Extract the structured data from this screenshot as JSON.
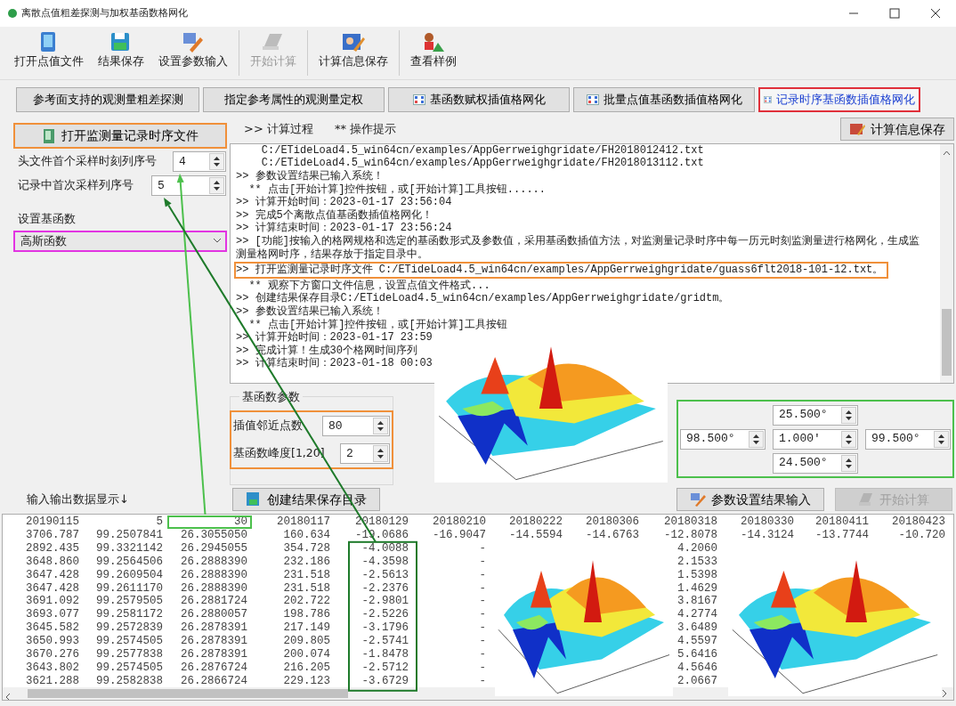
{
  "window": {
    "title": "离散点值粗差探测与加权基函数格网化"
  },
  "toolbar": [
    {
      "label": "打开点值文件",
      "disabled": false
    },
    {
      "label": "结果保存",
      "disabled": false
    },
    {
      "label": "设置参数输入",
      "disabled": false
    },
    {
      "label": "开始计算",
      "disabled": true
    },
    {
      "label": "计算信息保存",
      "disabled": false
    },
    {
      "label": "查看样例",
      "disabled": false
    }
  ],
  "tabs": [
    {
      "label": "参考面支持的观测量粗差探测",
      "kind": "text",
      "selected": false
    },
    {
      "label": "指定参考属性的观测量定权",
      "kind": "text",
      "selected": false
    },
    {
      "label": "基函数赋权插值格网化",
      "kind": "icon",
      "selected": false
    },
    {
      "label": "批量点值基函数插值格网化",
      "kind": "icon",
      "selected": false
    },
    {
      "label": "记录时序基函数插值格网化",
      "kind": "icon",
      "selected": true
    }
  ],
  "left_panel": {
    "open_button": "打开监测量记录时序文件",
    "fields": [
      {
        "label": "头文件首个采样时刻列序号",
        "value": "4"
      },
      {
        "label": "记录中首次采样列序号",
        "value": "5"
      }
    ],
    "group_title": "设置基函数",
    "function_select": {
      "value": "高斯函数"
    }
  },
  "log_panel": {
    "process_label": ">> 计算过程",
    "hint_label": "** 操作提示",
    "save_button": "计算信息保存",
    "lines": [
      {
        "text": "    C:/ETideLoad4.5_win64cn/examples/AppGerrweighgridate/FH2018012412.txt",
        "highlighted": false
      },
      {
        "text": "    C:/ETideLoad4.5_win64cn/examples/AppGerrweighgridate/FH2018013112.txt",
        "highlighted": false
      },
      {
        "text": ">> 参数设置结果已输入系统！",
        "highlighted": false
      },
      {
        "text": "  ** 点击[开始计算]控件按钮，或[开始计算]工具按钮......",
        "highlighted": false
      },
      {
        "text": ">> 计算开始时间：2023-01-17 23:56:04",
        "highlighted": false
      },
      {
        "text": ">> 完成5个离散点值基函数插值格网化！",
        "highlighted": false
      },
      {
        "text": ">> 计算结束时间：2023-01-17 23:56:24",
        "highlighted": false
      },
      {
        "text": ">> [功能]按输入的格网规格和选定的基函数形式及参数值，采用基函数插值方法，对监测量记录时序中每一历元时刻监测量进行格网化，生成监测量格网时序，结果存放于指定目录中。",
        "highlighted": false
      },
      {
        "text": ">> 打开监测量记录时序文件 C:/ETideLoad4.5_win64cn/examples/AppGerrweighgridate/guass6flt2018-101-12.txt。",
        "highlighted": true
      },
      {
        "text": "  ** 观察下方窗口文件信息，设置点值文件格式...",
        "highlighted": false
      },
      {
        "text": ">> 创建结果保存目录C:/ETideLoad4.5_win64cn/examples/AppGerrweighgridate/gridtm。",
        "highlighted": false
      },
      {
        "text": ">> 参数设置结果已输入系统！",
        "highlighted": false
      },
      {
        "text": "  ** 点击[开始计算]控件按钮，或[开始计算]工具按钮",
        "highlighted": false
      },
      {
        "text": ">> 计算开始时间：2023-01-17 23:59",
        "highlighted": false
      },
      {
        "text": ">> 完成计算！生成30个格网时间序列",
        "highlighted": false
      },
      {
        "text": ">> 计算结束时间：2023-01-18 00:03",
        "highlighted": false
      }
    ]
  },
  "params": {
    "title": "基函数参数",
    "fields": [
      {
        "label": "插值邻近点数",
        "value": "80"
      },
      {
        "label": "基函数峰度[1,20]",
        "value": "2"
      }
    ]
  },
  "grid_spec": {
    "north": "25.500°",
    "west": "98.500°",
    "step": "1.000′",
    "east": "99.500°",
    "south": "24.500°"
  },
  "actions": {
    "io_label": "输入输出数据显示↓",
    "buttons": [
      {
        "label": "创建结果保存目录",
        "disabled": false
      },
      {
        "label": "参数设置结果输入",
        "disabled": false
      },
      {
        "label": "开始计算",
        "disabled": true
      }
    ]
  },
  "data_grid": {
    "header": [
      {
        "text": "20190115",
        "highlighted": false
      },
      {
        "text": "5",
        "highlighted": false
      },
      {
        "text": "30",
        "highlighted": true
      },
      {
        "text": "20180117",
        "highlighted": false
      },
      {
        "text": "20180129",
        "highlighted": false
      },
      {
        "text": "20180210",
        "highlighted": false
      },
      {
        "text": "20180222",
        "highlighted": false
      },
      {
        "text": "20180306",
        "highlighted": false
      },
      {
        "text": "20180318",
        "highlighted": false
      },
      {
        "text": "20180330",
        "highlighted": false
      },
      {
        "text": "20180411",
        "highlighted": false
      },
      {
        "text": "20180423",
        "highlighted": false
      }
    ],
    "rows": [
      [
        "3706.787",
        "99.2507841",
        "26.3055050",
        "160.634",
        "-19.0686",
        "-16.9047",
        "-14.5594",
        "-14.6763",
        "-12.8078",
        "-14.3124",
        "-13.7744",
        "-10.720"
      ],
      [
        "2892.435",
        "99.3321142",
        "26.2945055",
        "354.728",
        "-4.0088",
        "-",
        null,
        null,
        "4.2060",
        null,
        null,
        null
      ],
      [
        "3648.860",
        "99.2564506",
        "26.2888390",
        "232.186",
        "-4.3598",
        "-",
        null,
        null,
        "2.1533",
        null,
        null,
        null
      ],
      [
        "3647.428",
        "99.2609504",
        "26.2888390",
        "231.518",
        "-2.5613",
        "-",
        null,
        null,
        "1.5398",
        null,
        null,
        null
      ],
      [
        "3647.428",
        "99.2611170",
        "26.2888390",
        "231.518",
        "-2.2376",
        "-",
        null,
        null,
        "1.4629",
        null,
        null,
        null
      ],
      [
        "3691.092",
        "99.2579505",
        "26.2881724",
        "202.722",
        "-2.9801",
        "-",
        null,
        null,
        "3.8167",
        null,
        null,
        null
      ],
      [
        "3693.077",
        "99.2581172",
        "26.2880057",
        "198.786",
        "-2.5226",
        "-",
        null,
        null,
        "4.2774",
        null,
        null,
        null
      ],
      [
        "3645.582",
        "99.2572839",
        "26.2878391",
        "217.149",
        "-3.1796",
        "-",
        null,
        null,
        "3.6489",
        null,
        null,
        null
      ],
      [
        "3650.993",
        "99.2574505",
        "26.2878391",
        "209.805",
        "-2.5741",
        "-",
        null,
        null,
        "4.5597",
        null,
        null,
        null
      ],
      [
        "3670.276",
        "99.2577838",
        "26.2878391",
        "200.074",
        "-1.8478",
        "-",
        null,
        null,
        "5.6416",
        null,
        null,
        null
      ],
      [
        "3643.802",
        "99.2574505",
        "26.2876724",
        "216.205",
        "-2.5712",
        "-",
        null,
        null,
        "4.5646",
        null,
        null,
        null
      ],
      [
        "3621.288",
        "99.2582838",
        "26.2866724",
        "229.123",
        "-3.6729",
        "-",
        null,
        null,
        "2.0667",
        null,
        null,
        null
      ]
    ]
  }
}
